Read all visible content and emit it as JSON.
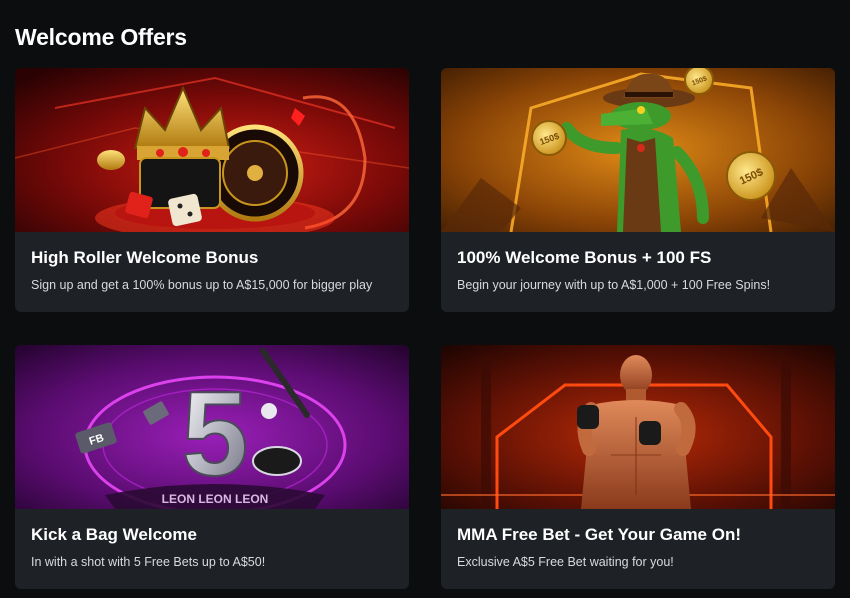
{
  "section": {
    "title": "Welcome Offers"
  },
  "offers": [
    {
      "title": "High Roller Welcome Bonus",
      "description": "Sign up and get a 100% bonus up to A$15,000 for bigger play",
      "image": "crown-roulette-dice-image"
    },
    {
      "title": "100% Welcome Bonus + 100 FS",
      "description": "Begin your journey with up to A$1,000 + 100 Free Spins!",
      "image": "cowboy-crocodile-coins-image",
      "coin_text": [
        "150$",
        "150$",
        "150$"
      ]
    },
    {
      "title": "Kick a Bag Welcome",
      "description": "In with a shot with 5 Free Bets up to A$50!",
      "image": "five-free-bets-image",
      "big_number": "5",
      "ticket_text": "FB",
      "ring_text": "LEON LEON LEON"
    },
    {
      "title": "MMA Free Bet - Get Your Game On!",
      "description": "Exclusive A$5 Free Bet waiting for you!",
      "image": "mma-fighter-image"
    }
  ],
  "colors": {
    "background": "#0b0d0f",
    "card": "#1e2226",
    "red_accent": "#e0221a",
    "orange_accent": "#d9780a",
    "purple_accent": "#b02ad0",
    "fire_accent": "#ff4a10"
  }
}
